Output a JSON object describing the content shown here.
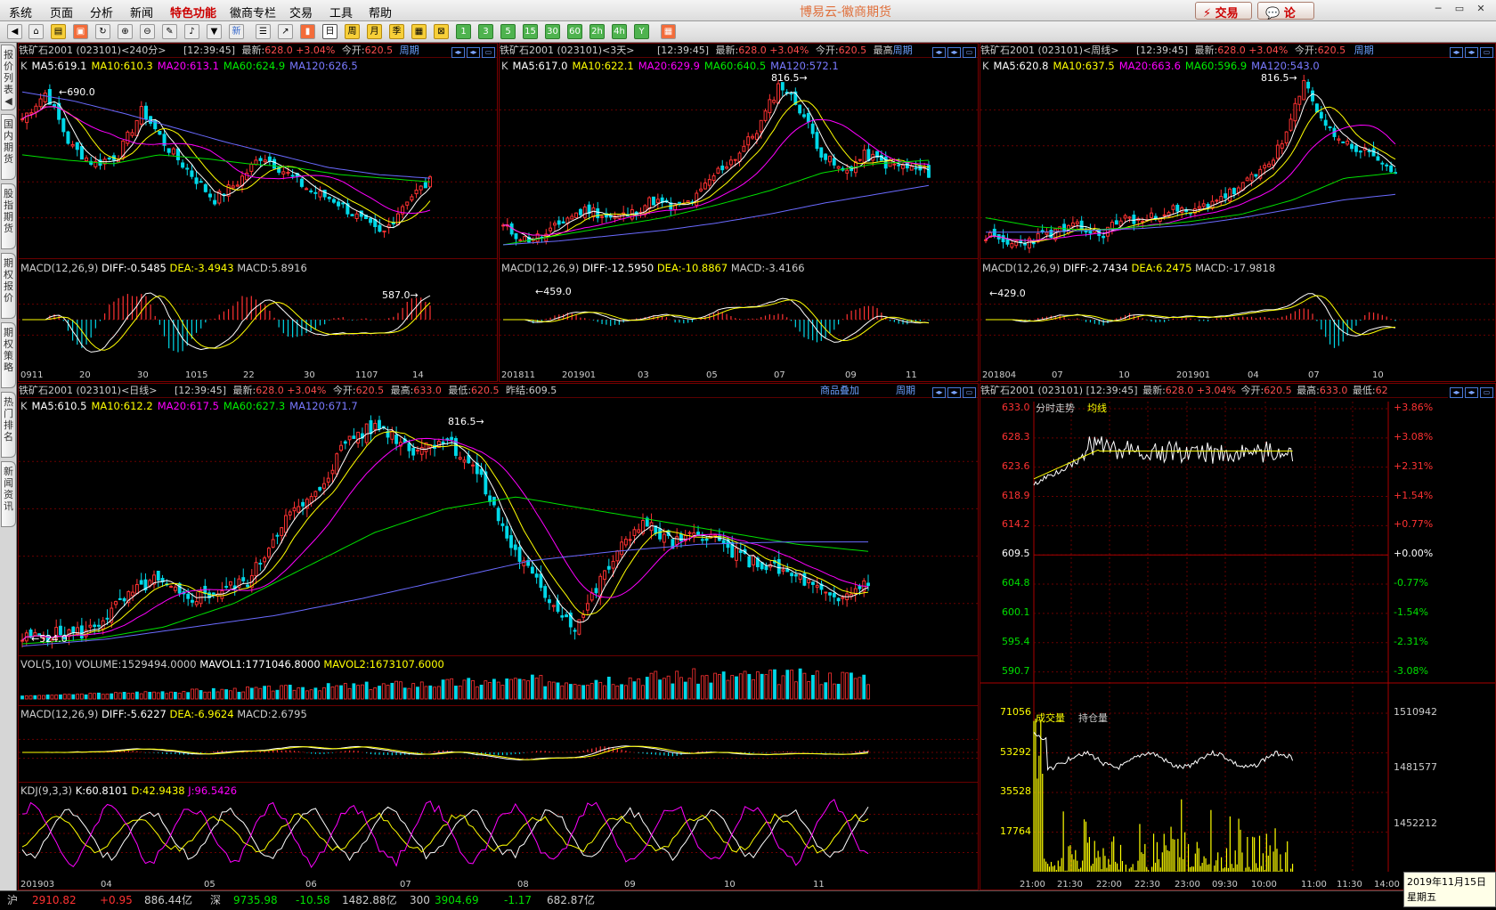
{
  "menu": {
    "items": [
      "系统",
      "页面",
      "分析",
      "新闻",
      "特色功能",
      "徽商专栏",
      "交易",
      "工具",
      "帮助"
    ],
    "title": "博易云-徽商期货",
    "trade": "交易",
    "forum": "论坛"
  },
  "toolbar": {
    "labels": [
      "15",
      "30",
      "60",
      "1",
      "3",
      "5",
      "15",
      "30",
      "60",
      "2h",
      "4h",
      "Y"
    ],
    "day": "日",
    "week": "周",
    "month": "月",
    "season": "季",
    "new": "新"
  },
  "sidebar": {
    "tabs": [
      "报价列表",
      "国内期货",
      "股指期货",
      "期权报价",
      "期权策略",
      "热门排名",
      "新闻资讯"
    ]
  },
  "p1": {
    "title": "铁矿石2001 (023101)<240分>",
    "time": "[12:39:45]",
    "latest_label": "最新:",
    "latest": "628.0",
    "chg": "+3.04%",
    "open_label": "今开:",
    "open": "620.5",
    "cycle": "周期",
    "ma_k": "K",
    "ma5": "MA5:619.1",
    "ma10": "MA10:610.3",
    "ma20": "MA20:613.1",
    "ma60": "MA60:624.9",
    "ma120": "MA120:626.5",
    "hi": "690.0",
    "lo": "587.0",
    "macd_name": "MACD(12,26,9)",
    "diff": "DIFF:-0.5485",
    "dea": "DEA:-3.4943",
    "macd": "MACD:5.8916",
    "xticks": [
      "0911",
      "20",
      "30",
      "1015",
      "22",
      "30",
      "1107",
      "14"
    ]
  },
  "p2": {
    "title": "铁矿石2001 (023101)<3天>",
    "time": "[12:39:45]",
    "latest_label": "最新:",
    "latest": "628.0",
    "chg": "+3.04%",
    "open_label": "今开:",
    "open": "620.5",
    "extra": "最高",
    "cycle": "周期",
    "ma_k": "K",
    "ma5": "MA5:617.0",
    "ma10": "MA10:622.1",
    "ma20": "MA20:629.9",
    "ma60": "MA60:640.5",
    "ma120": "MA120:572.1",
    "hi": "816.5",
    "lo": "459.0",
    "macd_name": "MACD(12,26,9)",
    "diff": "DIFF:-12.5950",
    "dea": "DEA:-10.8867",
    "macd": "MACD:-3.4166",
    "xticks": [
      "201811",
      "201901",
      "03",
      "05",
      "07",
      "09",
      "11"
    ]
  },
  "p3": {
    "title": "铁矿石2001 (023101)<周线>",
    "time": "[12:39:45]",
    "latest_label": "最新:",
    "latest": "628.0",
    "chg": "+3.04%",
    "open_label": "今开:",
    "open": "620.5",
    "cycle": "周期",
    "ma_k": "K",
    "ma5": "MA5:620.8",
    "ma10": "MA10:637.5",
    "ma20": "MA20:663.6",
    "ma60": "MA60:596.9",
    "ma120": "MA120:543.0",
    "hi": "816.5",
    "lo": "429.0",
    "macd_name": "MACD(12,26,9)",
    "diff": "DIFF:-2.7434",
    "dea": "DEA:6.2475",
    "macd": "MACD:-17.9818",
    "xticks": [
      "201804",
      "07",
      "10",
      "201901",
      "04",
      "07",
      "10"
    ]
  },
  "p4": {
    "title": "铁矿石2001 (023101)<日线>",
    "time": "[12:39:45]",
    "latest_label": "最新:",
    "latest": "628.0",
    "chg": "+3.04%",
    "open_label": "今开:",
    "open": "620.5",
    "high_label": "最高:",
    "high": "633.0",
    "low_label": "最低:",
    "low": "620.5",
    "prev_label": "昨结:",
    "prev": "609.5",
    "overlay": "商品叠加",
    "cycle": "周期",
    "ma_k": "K",
    "ma5": "MA5:610.5",
    "ma10": "MA10:612.2",
    "ma20": "MA20:617.5",
    "ma60": "MA60:627.3",
    "ma120": "MA120:671.7",
    "hi": "816.5",
    "lo": "524.0",
    "vol_name": "VOL(5,10)",
    "volume": "VOLUME:1529494.0000",
    "mavol1": "MAVOL1:1771046.8000",
    "mavol2": "MAVOL2:1673107.6000",
    "macd_name": "MACD(12,26,9)",
    "diff": "DIFF:-5.6227",
    "dea": "DEA:-6.9624",
    "macd": "MACD:2.6795",
    "kdj_name": "KDJ(9,3,3)",
    "k": "K:60.8101",
    "d": "D:42.9438",
    "j": "J:96.5426",
    "xticks": [
      "201903",
      "04",
      "05",
      "06",
      "07",
      "08",
      "09",
      "10",
      "11"
    ]
  },
  "p5": {
    "title": "铁矿石2001 (023101)",
    "time": "[12:39:45]",
    "latest_label": "最新:",
    "latest": "628.0",
    "chg": "+3.04%",
    "open_label": "今开:",
    "open": "620.5",
    "high_label": "最高:",
    "high": "633.0",
    "low_label": "最低:",
    "low_trunc": "62",
    "line1": "分时走势",
    "line2": "均线",
    "prices": [
      "633.0",
      "628.3",
      "623.6",
      "618.9",
      "614.2",
      "609.5",
      "604.8",
      "600.1",
      "595.4",
      "590.7"
    ],
    "pcts": [
      "+3.86%",
      "+3.08%",
      "+2.31%",
      "+1.54%",
      "+0.77%",
      "+0.00%",
      "-0.77%",
      "-1.54%",
      "-2.31%",
      "-3.08%"
    ],
    "vol_label": "成交量",
    "oi_label": "持仓量",
    "vol_ticks": [
      "71056",
      "53292",
      "35528",
      "17764"
    ],
    "oi_ticks": [
      "1510942",
      "1481577",
      "1452212"
    ],
    "xticks": [
      "21:00",
      "21:30",
      "22:00",
      "22:30",
      "23:00",
      "09:30",
      "10:00",
      "11:00",
      "11:30",
      "14:00"
    ]
  },
  "status": {
    "sh": "沪",
    "sh_idx": "2910.82",
    "sh_chg": "+0.95",
    "sh_amt": "886.44亿",
    "sz": "深",
    "sz_idx": "9735.98",
    "sz_chg": "-10.58",
    "sz_amt": "1482.88亿",
    "c300": "300",
    "c300_idx": "3904.69",
    "c300_chg": "-1.17",
    "c300_amt": "682.87亿"
  },
  "clock": {
    "date": "2019年11月15日",
    "weekday": "星期五"
  },
  "colors": {
    "up": "#ff3232",
    "down": "#00d8e8",
    "ma5": "#ffffff",
    "ma10": "#ffff00",
    "ma20": "#ff00ff",
    "ma60": "#00e000",
    "ma120": "#6a6aff",
    "grid": "#6a0000"
  }
}
